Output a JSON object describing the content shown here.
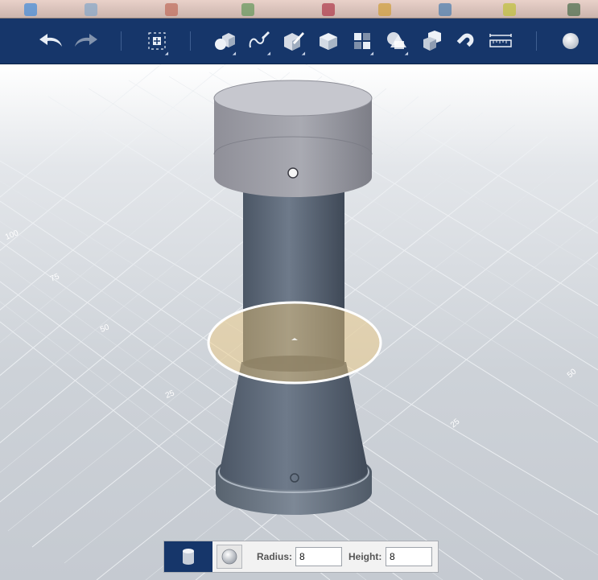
{
  "toolbar": {
    "tools": [
      {
        "name": "undo-icon",
        "has_menu": false
      },
      {
        "name": "redo-icon",
        "has_menu": false
      },
      {
        "name": "transform-icon",
        "has_menu": true
      },
      {
        "name": "primitives-icon",
        "has_menu": true
      },
      {
        "name": "sketch-icon",
        "has_menu": true
      },
      {
        "name": "construct-icon",
        "has_menu": true
      },
      {
        "name": "modify-icon",
        "has_menu": false
      },
      {
        "name": "pattern-icon",
        "has_menu": true
      },
      {
        "name": "grouping-icon",
        "has_menu": true
      },
      {
        "name": "combine-icon",
        "has_menu": false
      },
      {
        "name": "snap-icon",
        "has_menu": false
      },
      {
        "name": "measure-icon",
        "has_menu": false
      },
      {
        "name": "material-icon",
        "has_menu": false
      }
    ]
  },
  "grid": {
    "labels": [
      "100",
      "75",
      "50",
      "25",
      "25",
      "50"
    ]
  },
  "model": {
    "selection_color": "#f1c97a",
    "body_color": "#5e6b7a",
    "cap_color": "#8d8f97"
  },
  "params": {
    "radius_label": "Radius:",
    "radius_value": "8",
    "height_label": "Height:",
    "height_value": "8"
  }
}
